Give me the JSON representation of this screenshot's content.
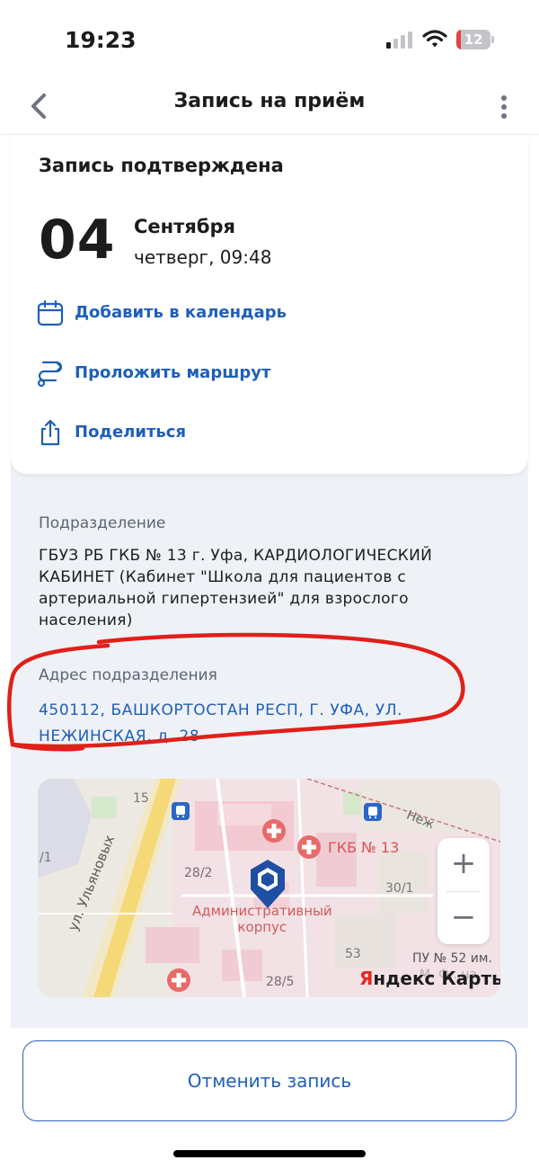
{
  "status_bar": {
    "time": "19:23",
    "battery_level": "12",
    "battery_fraction": 0.12,
    "signal_icon": "cellular-signal-icon",
    "wifi_icon": "wifi-icon",
    "battery_icon": "battery-icon"
  },
  "nav": {
    "title": "Запись на приём",
    "back_icon": "chevron-left-icon",
    "more_icon": "more-vertical-icon"
  },
  "appointment": {
    "status_title": "Запись подтверждена",
    "day": "04",
    "month": "Сентября",
    "weekday_time": "четверг, 09:48",
    "actions": [
      {
        "label": "Добавить в календарь",
        "icon": "calendar-icon"
      },
      {
        "label": "Проложить маршрут",
        "icon": "route-icon"
      },
      {
        "label": "Поделиться",
        "icon": "share-icon"
      }
    ]
  },
  "details": {
    "division_label": "Подразделение",
    "division_name": "ГБУЗ РБ ГКБ № 13 г. Уфа, КАРДИОЛОГИЧЕСКИЙ КАБИНЕТ (Кабинет \"Школа для пациентов с артериальной гипертензией\" для взрослого населения)",
    "address_label": "Адрес подразделения",
    "address": "450112, БАШКОРТОСТАН РЕСП, Г. УФА, УЛ. НЕЖИНСКАЯ, д. 28"
  },
  "map": {
    "labels": {
      "house_15": "15",
      "house_1": "/1",
      "house_28_2": "28/2",
      "house_30_1": "30/1",
      "house_53": "53",
      "house_28_5": "28/5",
      "street_ulyanovykh": "ул. Ульяновых",
      "street_nezh": "Неж",
      "hospital": "ГКБ № 13",
      "admin_building_line1": "Административный",
      "admin_building_line2": "корпус",
      "pu_label": "ПУ № 52 им.",
      "pu_label_2": "М. Ф...на"
    },
    "zoom_in": "+",
    "zoom_out": "−",
    "brand_first": "Я",
    "brand_rest": "ндекс Карты",
    "pin_icon": "location-pin-icon",
    "hospital_icon": "hospital-cross-icon",
    "bus_stop_icon": "bus-stop-icon"
  },
  "cancel_label": "Отменить запись",
  "colors": {
    "accent": "#1f5fb8",
    "background": "#eef1f6",
    "annotation": "#e0201a",
    "battery_low": "#e0433b"
  }
}
